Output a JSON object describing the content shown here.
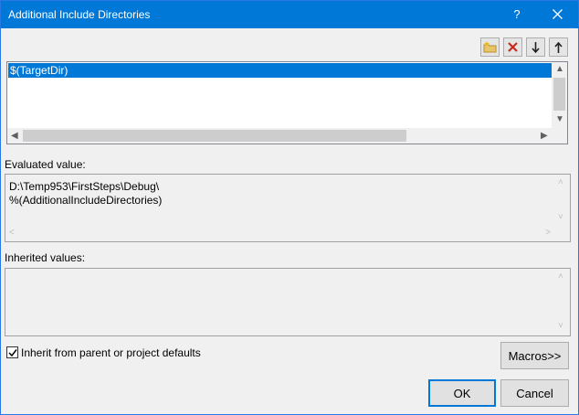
{
  "window": {
    "title": "Additional Include Directories",
    "help_label": "?"
  },
  "toolbar": {
    "buttons": [
      {
        "icon": "new-folder-icon"
      },
      {
        "icon": "delete-icon"
      },
      {
        "icon": "move-down-icon"
      },
      {
        "icon": "move-up-icon"
      }
    ]
  },
  "directory_list": {
    "items": [
      "$(TargetDir)"
    ],
    "selected_index": 0
  },
  "evaluated": {
    "label": "Evaluated value:",
    "lines": [
      "D:\\Temp953\\FirstSteps\\Debug\\",
      "%(AdditionalIncludeDirectories)"
    ]
  },
  "inherited": {
    "label": "Inherited values:",
    "lines": []
  },
  "inherit_checkbox": {
    "label": "Inherit from parent or project defaults",
    "checked": true
  },
  "buttons": {
    "macros": "Macros>>",
    "ok": "OK",
    "cancel": "Cancel"
  },
  "colors": {
    "accent": "#0078d7",
    "delete": "#c42b1c"
  }
}
